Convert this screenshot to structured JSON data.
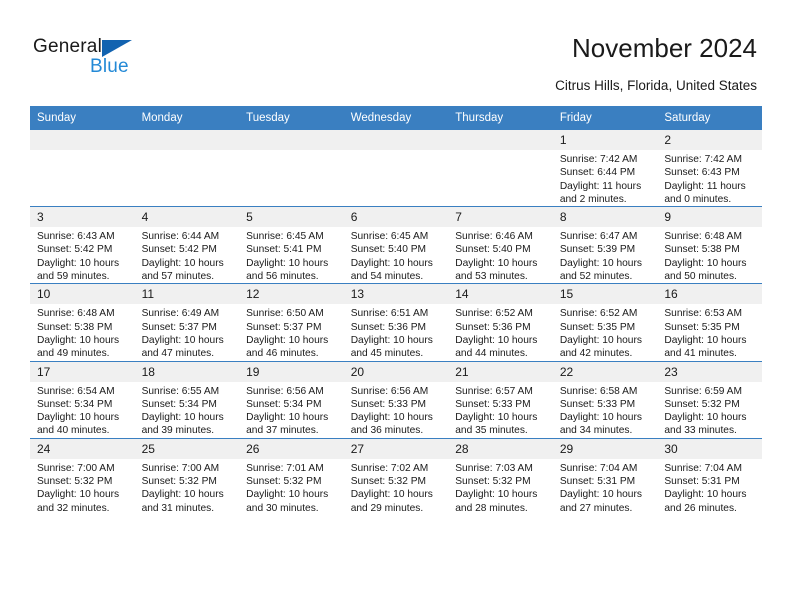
{
  "logo": {
    "primary": "General",
    "secondary": "Blue",
    "accent_color": "#1263b0",
    "secondary_color": "#2389d6"
  },
  "header": {
    "title": "November 2024",
    "subtitle": "Citrus Hills, Florida, United States"
  },
  "calendar": {
    "header_color": "#3a7fc1",
    "daynum_bg": "#f0f0f0",
    "weekdays": [
      "Sunday",
      "Monday",
      "Tuesday",
      "Wednesday",
      "Thursday",
      "Friday",
      "Saturday"
    ],
    "weeks": [
      [
        {
          "day": "",
          "sunrise": "",
          "sunset": "",
          "daylight": "",
          "empty": true
        },
        {
          "day": "",
          "sunrise": "",
          "sunset": "",
          "daylight": "",
          "empty": true
        },
        {
          "day": "",
          "sunrise": "",
          "sunset": "",
          "daylight": "",
          "empty": true
        },
        {
          "day": "",
          "sunrise": "",
          "sunset": "",
          "daylight": "",
          "empty": true
        },
        {
          "day": "",
          "sunrise": "",
          "sunset": "",
          "daylight": "",
          "empty": true
        },
        {
          "day": "1",
          "sunrise": "Sunrise: 7:42 AM",
          "sunset": "Sunset: 6:44 PM",
          "daylight": "Daylight: 11 hours and 2 minutes.",
          "empty": false
        },
        {
          "day": "2",
          "sunrise": "Sunrise: 7:42 AM",
          "sunset": "Sunset: 6:43 PM",
          "daylight": "Daylight: 11 hours and 0 minutes.",
          "empty": false
        }
      ],
      [
        {
          "day": "3",
          "sunrise": "Sunrise: 6:43 AM",
          "sunset": "Sunset: 5:42 PM",
          "daylight": "Daylight: 10 hours and 59 minutes.",
          "empty": false
        },
        {
          "day": "4",
          "sunrise": "Sunrise: 6:44 AM",
          "sunset": "Sunset: 5:42 PM",
          "daylight": "Daylight: 10 hours and 57 minutes.",
          "empty": false
        },
        {
          "day": "5",
          "sunrise": "Sunrise: 6:45 AM",
          "sunset": "Sunset: 5:41 PM",
          "daylight": "Daylight: 10 hours and 56 minutes.",
          "empty": false
        },
        {
          "day": "6",
          "sunrise": "Sunrise: 6:45 AM",
          "sunset": "Sunset: 5:40 PM",
          "daylight": "Daylight: 10 hours and 54 minutes.",
          "empty": false
        },
        {
          "day": "7",
          "sunrise": "Sunrise: 6:46 AM",
          "sunset": "Sunset: 5:40 PM",
          "daylight": "Daylight: 10 hours and 53 minutes.",
          "empty": false
        },
        {
          "day": "8",
          "sunrise": "Sunrise: 6:47 AM",
          "sunset": "Sunset: 5:39 PM",
          "daylight": "Daylight: 10 hours and 52 minutes.",
          "empty": false
        },
        {
          "day": "9",
          "sunrise": "Sunrise: 6:48 AM",
          "sunset": "Sunset: 5:38 PM",
          "daylight": "Daylight: 10 hours and 50 minutes.",
          "empty": false
        }
      ],
      [
        {
          "day": "10",
          "sunrise": "Sunrise: 6:48 AM",
          "sunset": "Sunset: 5:38 PM",
          "daylight": "Daylight: 10 hours and 49 minutes.",
          "empty": false
        },
        {
          "day": "11",
          "sunrise": "Sunrise: 6:49 AM",
          "sunset": "Sunset: 5:37 PM",
          "daylight": "Daylight: 10 hours and 47 minutes.",
          "empty": false
        },
        {
          "day": "12",
          "sunrise": "Sunrise: 6:50 AM",
          "sunset": "Sunset: 5:37 PM",
          "daylight": "Daylight: 10 hours and 46 minutes.",
          "empty": false
        },
        {
          "day": "13",
          "sunrise": "Sunrise: 6:51 AM",
          "sunset": "Sunset: 5:36 PM",
          "daylight": "Daylight: 10 hours and 45 minutes.",
          "empty": false
        },
        {
          "day": "14",
          "sunrise": "Sunrise: 6:52 AM",
          "sunset": "Sunset: 5:36 PM",
          "daylight": "Daylight: 10 hours and 44 minutes.",
          "empty": false
        },
        {
          "day": "15",
          "sunrise": "Sunrise: 6:52 AM",
          "sunset": "Sunset: 5:35 PM",
          "daylight": "Daylight: 10 hours and 42 minutes.",
          "empty": false
        },
        {
          "day": "16",
          "sunrise": "Sunrise: 6:53 AM",
          "sunset": "Sunset: 5:35 PM",
          "daylight": "Daylight: 10 hours and 41 minutes.",
          "empty": false
        }
      ],
      [
        {
          "day": "17",
          "sunrise": "Sunrise: 6:54 AM",
          "sunset": "Sunset: 5:34 PM",
          "daylight": "Daylight: 10 hours and 40 minutes.",
          "empty": false
        },
        {
          "day": "18",
          "sunrise": "Sunrise: 6:55 AM",
          "sunset": "Sunset: 5:34 PM",
          "daylight": "Daylight: 10 hours and 39 minutes.",
          "empty": false
        },
        {
          "day": "19",
          "sunrise": "Sunrise: 6:56 AM",
          "sunset": "Sunset: 5:34 PM",
          "daylight": "Daylight: 10 hours and 37 minutes.",
          "empty": false
        },
        {
          "day": "20",
          "sunrise": "Sunrise: 6:56 AM",
          "sunset": "Sunset: 5:33 PM",
          "daylight": "Daylight: 10 hours and 36 minutes.",
          "empty": false
        },
        {
          "day": "21",
          "sunrise": "Sunrise: 6:57 AM",
          "sunset": "Sunset: 5:33 PM",
          "daylight": "Daylight: 10 hours and 35 minutes.",
          "empty": false
        },
        {
          "day": "22",
          "sunrise": "Sunrise: 6:58 AM",
          "sunset": "Sunset: 5:33 PM",
          "daylight": "Daylight: 10 hours and 34 minutes.",
          "empty": false
        },
        {
          "day": "23",
          "sunrise": "Sunrise: 6:59 AM",
          "sunset": "Sunset: 5:32 PM",
          "daylight": "Daylight: 10 hours and 33 minutes.",
          "empty": false
        }
      ],
      [
        {
          "day": "24",
          "sunrise": "Sunrise: 7:00 AM",
          "sunset": "Sunset: 5:32 PM",
          "daylight": "Daylight: 10 hours and 32 minutes.",
          "empty": false
        },
        {
          "day": "25",
          "sunrise": "Sunrise: 7:00 AM",
          "sunset": "Sunset: 5:32 PM",
          "daylight": "Daylight: 10 hours and 31 minutes.",
          "empty": false
        },
        {
          "day": "26",
          "sunrise": "Sunrise: 7:01 AM",
          "sunset": "Sunset: 5:32 PM",
          "daylight": "Daylight: 10 hours and 30 minutes.",
          "empty": false
        },
        {
          "day": "27",
          "sunrise": "Sunrise: 7:02 AM",
          "sunset": "Sunset: 5:32 PM",
          "daylight": "Daylight: 10 hours and 29 minutes.",
          "empty": false
        },
        {
          "day": "28",
          "sunrise": "Sunrise: 7:03 AM",
          "sunset": "Sunset: 5:32 PM",
          "daylight": "Daylight: 10 hours and 28 minutes.",
          "empty": false
        },
        {
          "day": "29",
          "sunrise": "Sunrise: 7:04 AM",
          "sunset": "Sunset: 5:31 PM",
          "daylight": "Daylight: 10 hours and 27 minutes.",
          "empty": false
        },
        {
          "day": "30",
          "sunrise": "Sunrise: 7:04 AM",
          "sunset": "Sunset: 5:31 PM",
          "daylight": "Daylight: 10 hours and 26 minutes.",
          "empty": false
        }
      ]
    ]
  }
}
